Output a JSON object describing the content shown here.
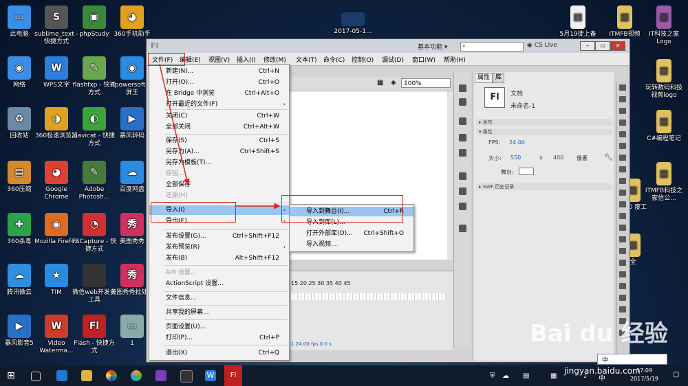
{
  "desktop_left": [
    {
      "label": "此电脑",
      "color": "#3a8ee6",
      "glyph": "▭"
    },
    {
      "label": "网络",
      "color": "#3a8ee6",
      "glyph": "◉"
    },
    {
      "label": "回收站",
      "color": "#6b8aa8",
      "glyph": "♻"
    },
    {
      "label": "360压缩",
      "color": "#d48a2a",
      "glyph": "▤"
    },
    {
      "label": "360杀毒",
      "color": "#2aa34a",
      "glyph": "✚"
    },
    {
      "label": "腾讯微云",
      "color": "#2e8fe0",
      "glyph": "☁"
    },
    {
      "label": "暴风影音5",
      "color": "#2a6fc6",
      "glyph": "▶"
    }
  ],
  "desktop_col2": [
    {
      "label": "sublime_text - 快捷方式",
      "color": "#555",
      "glyph": "S"
    },
    {
      "label": "WPS文字",
      "color": "#2a7ee0",
      "glyph": "W"
    },
    {
      "label": "360极速浏览器",
      "color": "#e0a020",
      "glyph": "◑"
    },
    {
      "label": "Google Chrome",
      "color": "#e04030",
      "glyph": "◕"
    },
    {
      "label": "Mozilla Firefox",
      "color": "#e06a20",
      "glyph": "◉"
    },
    {
      "label": "TIM",
      "color": "#2a8be0",
      "glyph": "★"
    },
    {
      "label": "Video Waterma...",
      "color": "#d03a2a",
      "glyph": "W"
    }
  ],
  "desktop_col3": [
    {
      "label": "phpStudy",
      "color": "#3a8a3a",
      "glyph": "▣"
    },
    {
      "label": "flashfxp - 快捷方式",
      "color": "#6aa84f",
      "glyph": "✎"
    },
    {
      "label": "navicat - 快捷方式",
      "color": "#3aa33a",
      "glyph": "◐"
    },
    {
      "label": "Adobe Photosh...",
      "color": "#4a7a3a",
      "glyph": "✎"
    },
    {
      "label": "FSCapture - 快捷方式",
      "color": "#d03030",
      "glyph": "◔"
    },
    {
      "label": "微信web开发者工具",
      "color": "#333",
      "glyph": "</>"
    },
    {
      "label": "Flash - 快捷方式",
      "color": "#c02020",
      "glyph": "Fl"
    }
  ],
  "desktop_col4": [
    {
      "label": "360手机助手",
      "color": "#e0a020",
      "glyph": "◕"
    },
    {
      "label": "Apowersoft 录屏王",
      "color": "#2a8be0",
      "glyph": "◉"
    },
    {
      "label": "暴风转码",
      "color": "#2a6fc6",
      "glyph": "▶"
    },
    {
      "label": "百度网盘",
      "color": "#2a8be0",
      "glyph": "☁"
    },
    {
      "label": "美图秀秀",
      "color": "#d03060",
      "glyph": "秀"
    },
    {
      "label": "美图秀秀批处理",
      "color": "#d03060",
      "glyph": "秀"
    },
    {
      "label": "1",
      "color": "#8aa",
      "glyph": "▭"
    }
  ],
  "desktop_top_center": "2017-05-1...",
  "desktop_right": [
    {
      "label": "5月19徒上备",
      "color": "#f0f0f0",
      "glyph": "▤"
    },
    {
      "label": "ITMFB视频",
      "color": "#e0c060",
      "glyph": "▥"
    },
    {
      "label": "IT科技之家Logo",
      "color": "#9a5aa8",
      "glyph": "▥"
    },
    {
      "label": "玩转数码科技视频logo",
      "color": "#e0c060",
      "glyph": "▥"
    },
    {
      "label": "C#编程笔记",
      "color": "#e0c060",
      "glyph": "▥"
    },
    {
      "label": "ITMFB科技之家信公...",
      "color": "#e0c060",
      "glyph": "▥"
    },
    {
      "label": "P5.0 度工",
      "color": "#e0c060",
      "glyph": "▥"
    },
    {
      "label": "全",
      "color": "#e0c060",
      "glyph": "▥"
    }
  ],
  "flash": {
    "logo": "Fl",
    "workspace": "基本功能 ▾",
    "search_placeholder": "",
    "cs_live": "CS Live",
    "menus": [
      "文件(F)",
      "编辑(E)",
      "视图(V)",
      "插入(I)",
      "修改(M)",
      "文本(T)",
      "命令(C)",
      "控制(O)",
      "调试(D)",
      "窗口(W)",
      "帮助(H)"
    ],
    "zoom": "100%",
    "frame_numbers": "15   20   25   30   35   40   45",
    "timeline_status": "1   24.00 fps   0.0 s",
    "props": {
      "tab_props": "属性",
      "tab_lib": "库",
      "doc_icon": "Fl",
      "doc_label": "文档",
      "doc_name": "未命名-1",
      "publish": "发布",
      "properties": "属性",
      "fps_label": "FPS:",
      "fps_value": "24.00",
      "size_label": "大小:",
      "width": "550",
      "x": "x",
      "height": "400",
      "unit": "像素",
      "stage_label": "舞台:",
      "swf_history": "SWF 历史记录"
    }
  },
  "file_menu": [
    {
      "label": "新建(N)...",
      "shortcut": "Ctrl+N"
    },
    {
      "label": "打开(O)...",
      "shortcut": "Ctrl+O"
    },
    {
      "label": "在 Bridge 中浏览",
      "shortcut": "Ctrl+Alt+O"
    },
    {
      "label": "打开最近的文件(F)",
      "shortcut": ""
    },
    {
      "label": "关闭(C)",
      "shortcut": "Ctrl+W"
    },
    {
      "label": "全部关闭",
      "shortcut": "Ctrl+Alt+W"
    },
    {
      "label": "保存(S)",
      "shortcut": "Ctrl+S"
    },
    {
      "label": "另存为(A)...",
      "shortcut": "Ctrl+Shift+S"
    },
    {
      "label": "另存为模板(T)...",
      "shortcut": ""
    },
    {
      "label": "存回...",
      "shortcut": ""
    },
    {
      "label": "全部保存",
      "shortcut": ""
    },
    {
      "label": "还原(H)",
      "shortcut": ""
    },
    {
      "label": "导入(I)",
      "shortcut": ""
    },
    {
      "label": "导出(E)",
      "shortcut": ""
    },
    {
      "label": "发布设置(G)...",
      "shortcut": "Ctrl+Shift+F12"
    },
    {
      "label": "发布预览(R)",
      "shortcut": ""
    },
    {
      "label": "发布(B)",
      "shortcut": "Alt+Shift+F12"
    },
    {
      "label": "AIR 设置...",
      "shortcut": ""
    },
    {
      "label": "ActionScript 设置...",
      "shortcut": ""
    },
    {
      "label": "文件信息...",
      "shortcut": ""
    },
    {
      "label": "共享我的屏幕...",
      "shortcut": ""
    },
    {
      "label": "页面设置(U)...",
      "shortcut": ""
    },
    {
      "label": "打印(P)...",
      "shortcut": "Ctrl+P"
    },
    {
      "label": "退出(X)",
      "shortcut": "Ctrl+Q"
    }
  ],
  "import_menu": [
    {
      "label": "导入到舞台(I)...",
      "shortcut": "Ctrl+R"
    },
    {
      "label": "导入到库(L)...",
      "shortcut": ""
    },
    {
      "label": "打开外部库(O)...",
      "shortcut": "Ctrl+Shift+O"
    },
    {
      "label": "导入视频...",
      "shortcut": ""
    }
  ],
  "taskbar": {
    "time": "17:09",
    "date": "2017/5/19",
    "ime": "中"
  },
  "watermark": {
    "brand": "Bai du 经验",
    "url": "jingyan.baidu.com"
  },
  "colors": {
    "highlight": "#99c5ef",
    "annotation": "#e0231f"
  }
}
